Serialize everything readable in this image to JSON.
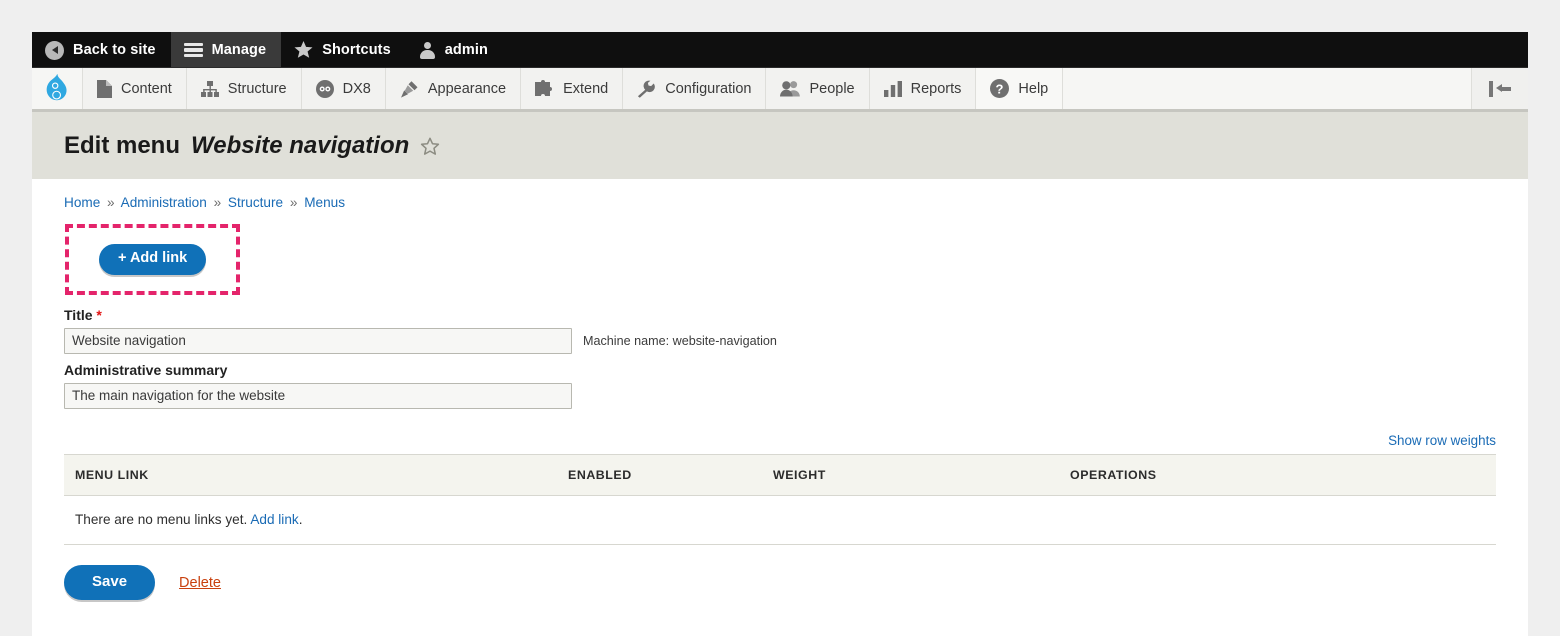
{
  "admin_toolbar": {
    "items": [
      {
        "label": "Back to site",
        "icon": "back-circle-icon",
        "active": false
      },
      {
        "label": "Manage",
        "icon": "hamburger-icon",
        "active": true
      },
      {
        "label": "Shortcuts",
        "icon": "star-icon",
        "active": false
      },
      {
        "label": "admin",
        "icon": "person-icon",
        "active": false
      }
    ]
  },
  "menu_toolbar": {
    "logo_icon": "drupal-logo-icon",
    "collapse_icon": "collapse-toolbar-icon",
    "items": [
      {
        "label": "Content",
        "icon": "document-icon"
      },
      {
        "label": "Structure",
        "icon": "sitemap-icon"
      },
      {
        "label": "DX8",
        "icon": "dx8-icon"
      },
      {
        "label": "Appearance",
        "icon": "paintbrush-icon"
      },
      {
        "label": "Extend",
        "icon": "puzzle-icon"
      },
      {
        "label": "Configuration",
        "icon": "wrench-icon"
      },
      {
        "label": "People",
        "icon": "people-icon"
      },
      {
        "label": "Reports",
        "icon": "bar-chart-icon"
      },
      {
        "label": "Help",
        "icon": "question-circle-icon"
      }
    ]
  },
  "header": {
    "title_prefix": "Edit menu",
    "title_name": "Website navigation",
    "favorite_icon": "star-outline-icon"
  },
  "breadcrumb": {
    "items": [
      {
        "label": "Home"
      },
      {
        "label": "Administration"
      },
      {
        "label": "Structure"
      },
      {
        "label": "Menus"
      }
    ],
    "separator": "»"
  },
  "highlight": {
    "add_link_label": "+ Add link",
    "border_color": "#e4246b"
  },
  "form": {
    "title_label": "Title",
    "title_required_marker": "*",
    "title_value": "Website navigation",
    "title_placeholder": "",
    "machine_name": "Machine name: website-navigation",
    "summary_label": "Administrative summary",
    "summary_value": "The main navigation for the website",
    "summary_placeholder": ""
  },
  "table": {
    "show_row_weights": "Show row weights",
    "columns": [
      "MENU LINK",
      "ENABLED",
      "WEIGHT",
      "OPERATIONS"
    ],
    "empty_text": "There are no menu links yet.",
    "empty_link": "Add link",
    "empty_text_suffix": "."
  },
  "actions": {
    "save_label": "Save",
    "delete_label": "Delete"
  },
  "colors": {
    "accent_blue": "#1071b8",
    "link_blue": "#1a6bb5",
    "highlight_pink": "#e4246b",
    "delete_red": "#c9400e",
    "title_band": "#e0e0d9",
    "toolbar_black": "#0f0f0f"
  }
}
